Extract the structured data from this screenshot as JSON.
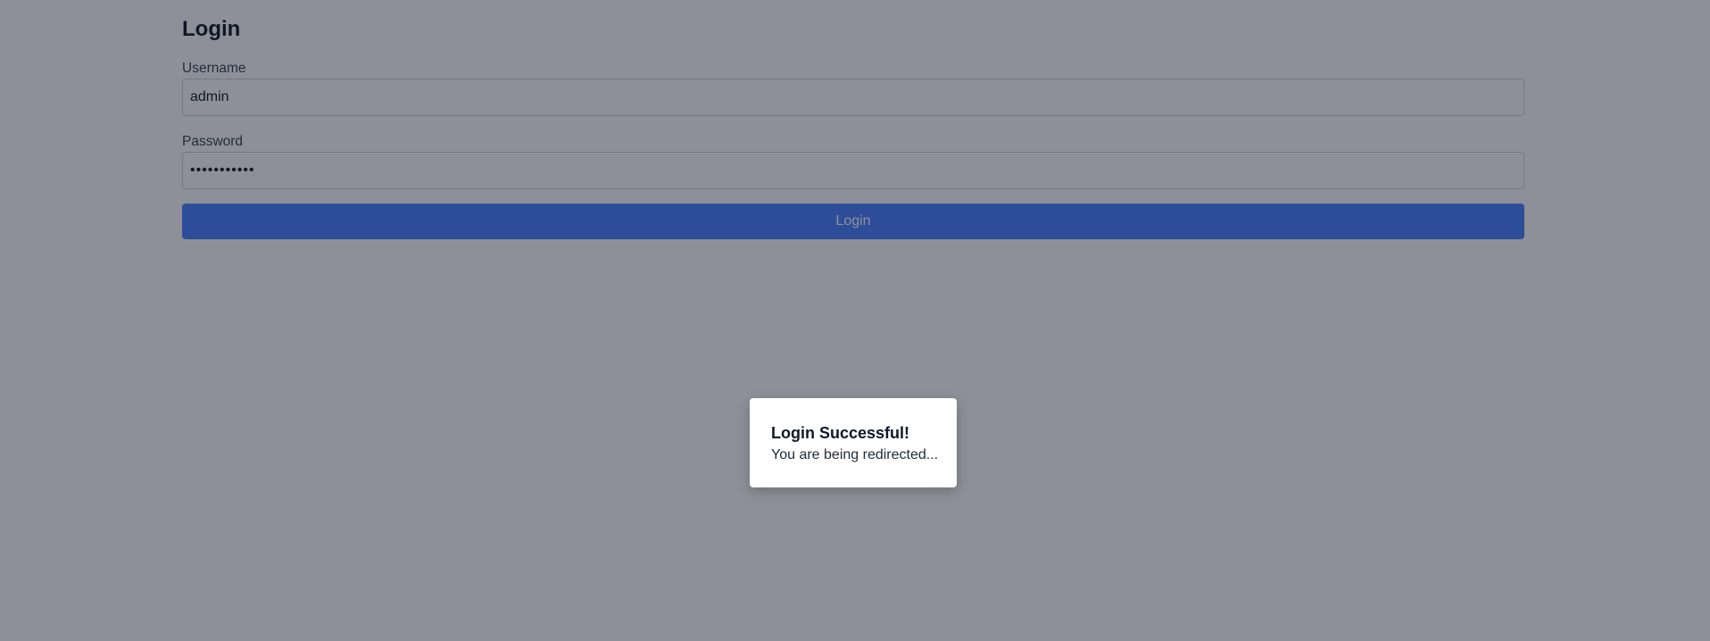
{
  "login": {
    "title": "Login",
    "username": {
      "label": "Username",
      "value": "admin"
    },
    "password": {
      "label": "Password",
      "value": "•••••••••••"
    },
    "submit_label": "Login"
  },
  "modal": {
    "title": "Login Successful!",
    "message": "You are being redirected..."
  },
  "colors": {
    "button_bg": "#4a7fff",
    "overlay": "rgba(17,24,39,0.48)",
    "dialog_bg": "#ffffff"
  }
}
